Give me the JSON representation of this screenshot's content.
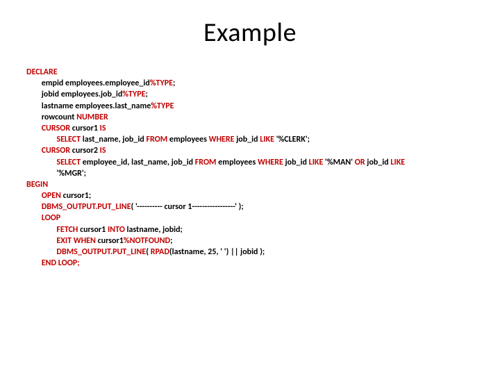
{
  "title": "Example",
  "code": {
    "l1": "DECLARE",
    "l2a": "        empid employees.employee_id",
    "l2b": "%TYPE",
    "l2c": ";",
    "l3a": "        jobid employees.job_id",
    "l3b": "%TYPE",
    "l3c": ";",
    "l4a": "        lastname employees.last_name",
    "l4b": "%TYPE",
    "l5a": "        rowcount ",
    "l5b": "NUMBER",
    "l6a": "        CURSOR",
    "l6b": " cursor1 ",
    "l6c": "IS",
    "l7a": "                SELECT",
    "l7b": " last_name, job_id ",
    "l7c": "FROM",
    "l7d": " employees ",
    "l7e": "WHERE",
    "l7f": " job_id ",
    "l7g": "LIKE",
    "l7h": " '%CLERK';",
    "l8a": "        CURSOR",
    "l8b": " cursor2 ",
    "l8c": "IS",
    "l9a": "                SELECT",
    "l9b": " employee_id, last_name, job_id ",
    "l9c": "FROM",
    "l9d": " employees ",
    "l9e": "WHERE",
    "l9f": " job_id ",
    "l9g": "LIKE",
    "l9h": " '%MAN' ",
    "l9i": "OR",
    "l9j": " job_id ",
    "l9k": "LIKE",
    "l10": "                '%MGR';",
    "l11": "BEGIN",
    "l12a": "        OPEN",
    "l12b": " cursor1;",
    "l13a": "        DBMS_OUTPUT.PUT_LINE",
    "l13b": "( '---------- cursor 1-----------------' );",
    "l14": "        LOOP",
    "l15a": "                FETCH",
    "l15b": " cursor1 ",
    "l15c": "INTO",
    "l15d": " lastname, jobid;",
    "l16a": "                EXIT WHEN",
    "l16b": " cursor1",
    "l16c": "%NOTFOUND",
    "l16d": ";",
    "l17a": "                DBMS_OUTPUT.PUT_LINE",
    "l17b": "( ",
    "l17c": "RPAD",
    "l17d": "(lastname, 25, ' ') || jobid );",
    "l18": "        END LOOP;"
  }
}
